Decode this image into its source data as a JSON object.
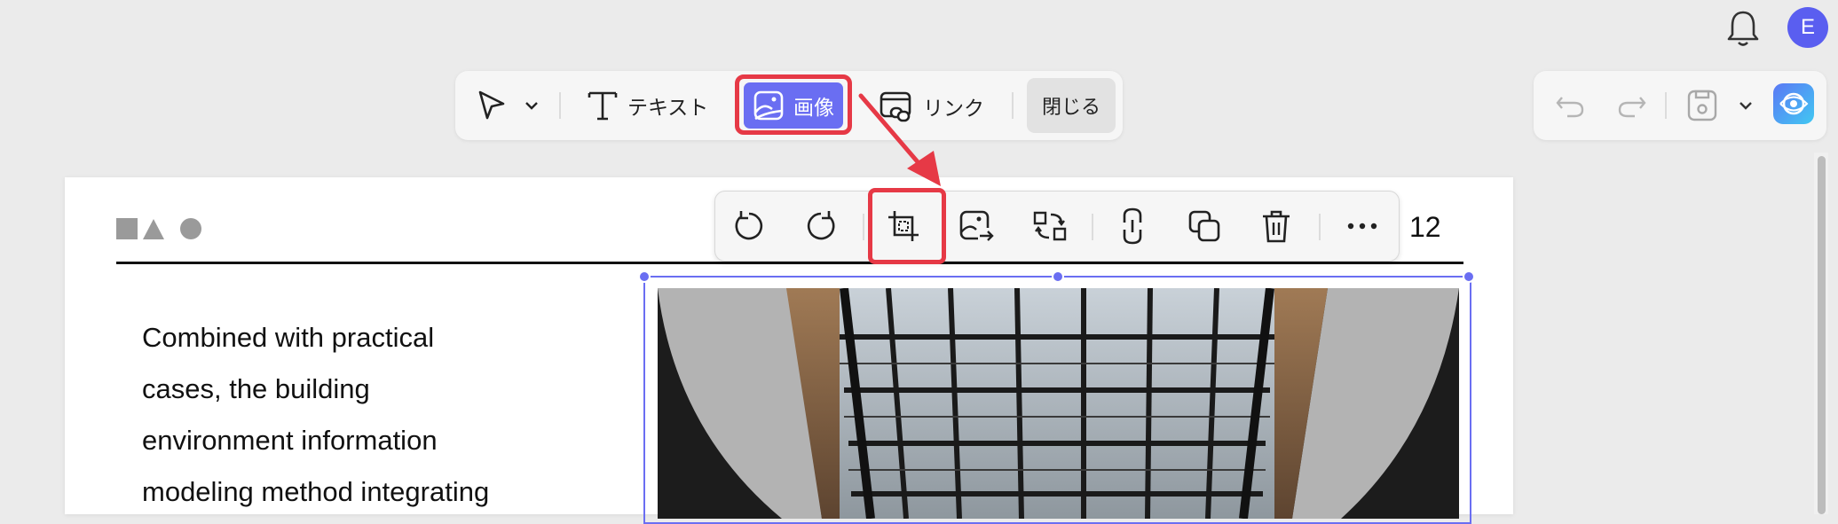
{
  "header": {
    "avatar_letter": "E"
  },
  "main_toolbar": {
    "text_label": "テキスト",
    "image_label": "画像",
    "link_label": "リンク",
    "close_label": "閉じる"
  },
  "document": {
    "page_number": "12",
    "body_lines": [
      "Combined with practical",
      "cases, the building",
      "environment information",
      "modeling method integrating"
    ]
  },
  "colors": {
    "accent": "#6a6ef2",
    "highlight": "#e63946",
    "avatar": "#5a5ef0"
  },
  "icons": {
    "toolbar": [
      "pointer-icon",
      "chevron-down-icon",
      "text-icon",
      "image-icon",
      "link-icon"
    ],
    "image_toolbar": [
      "rotate-left-icon",
      "rotate-right-icon",
      "crop-icon",
      "replace-image-icon",
      "flip-icon",
      "link-icon",
      "copy-icon",
      "trash-icon",
      "more-icon"
    ],
    "right_toolbar": [
      "undo-icon",
      "redo-icon",
      "save-icon",
      "chevron-down-icon",
      "ai-assistant-icon"
    ]
  }
}
